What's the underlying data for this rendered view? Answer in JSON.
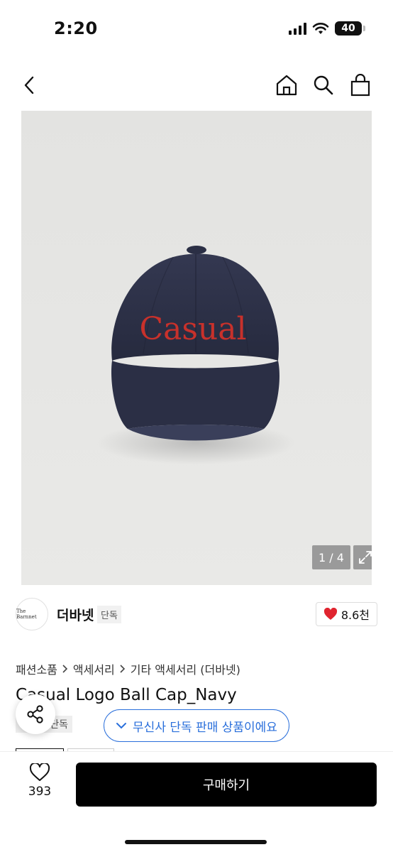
{
  "status_bar": {
    "time": "2:20",
    "battery": "40"
  },
  "nav": {
    "icons": [
      "back-icon",
      "home-icon",
      "search-icon",
      "shopping-bag-icon"
    ]
  },
  "gallery": {
    "image": "navy-casual-ball-cap",
    "image_text": "Casual",
    "counter": "1 / 4"
  },
  "brand": {
    "logo_text": "The Barnnet",
    "name": "더바넷",
    "tag": "단독",
    "likes": "8.6천"
  },
  "breadcrumb": [
    "패션소품",
    "액세서리",
    "기타 액세서리 (더바넷)"
  ],
  "product": {
    "title": "Casual Logo Ball Cap_Navy",
    "tag": "단독"
  },
  "exclusive_notice": "무신사 단독 판매 상품이에요",
  "bottom_bar": {
    "wish_count": "393",
    "buy_label": "구매하기"
  },
  "colors": {
    "accent_blue": "#2a6fdb",
    "heart_red": "#e0242f",
    "cap_navy": "#2b2f45",
    "logo_red": "#c8312b"
  }
}
